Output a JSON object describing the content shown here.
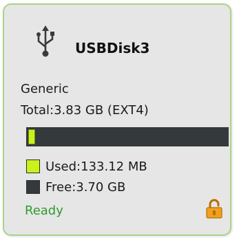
{
  "device": {
    "name": "USBDisk3",
    "icon": "usb-icon",
    "vendor": "Generic",
    "total_label": "Total:3.83 GB (EXT4)",
    "status": "Ready",
    "lock_icon": "unlock-icon"
  },
  "usage": {
    "used_fraction": 0.034,
    "used_label": "Used:133.12 MB",
    "free_label": "Free:3.70 GB"
  },
  "colors": {
    "card_border": "#a9d488",
    "card_background": "#e6e6e6",
    "used": "#c9f21a",
    "free": "#34393c",
    "status_ready": "#2e9a2e",
    "lock": "#f0a020"
  }
}
